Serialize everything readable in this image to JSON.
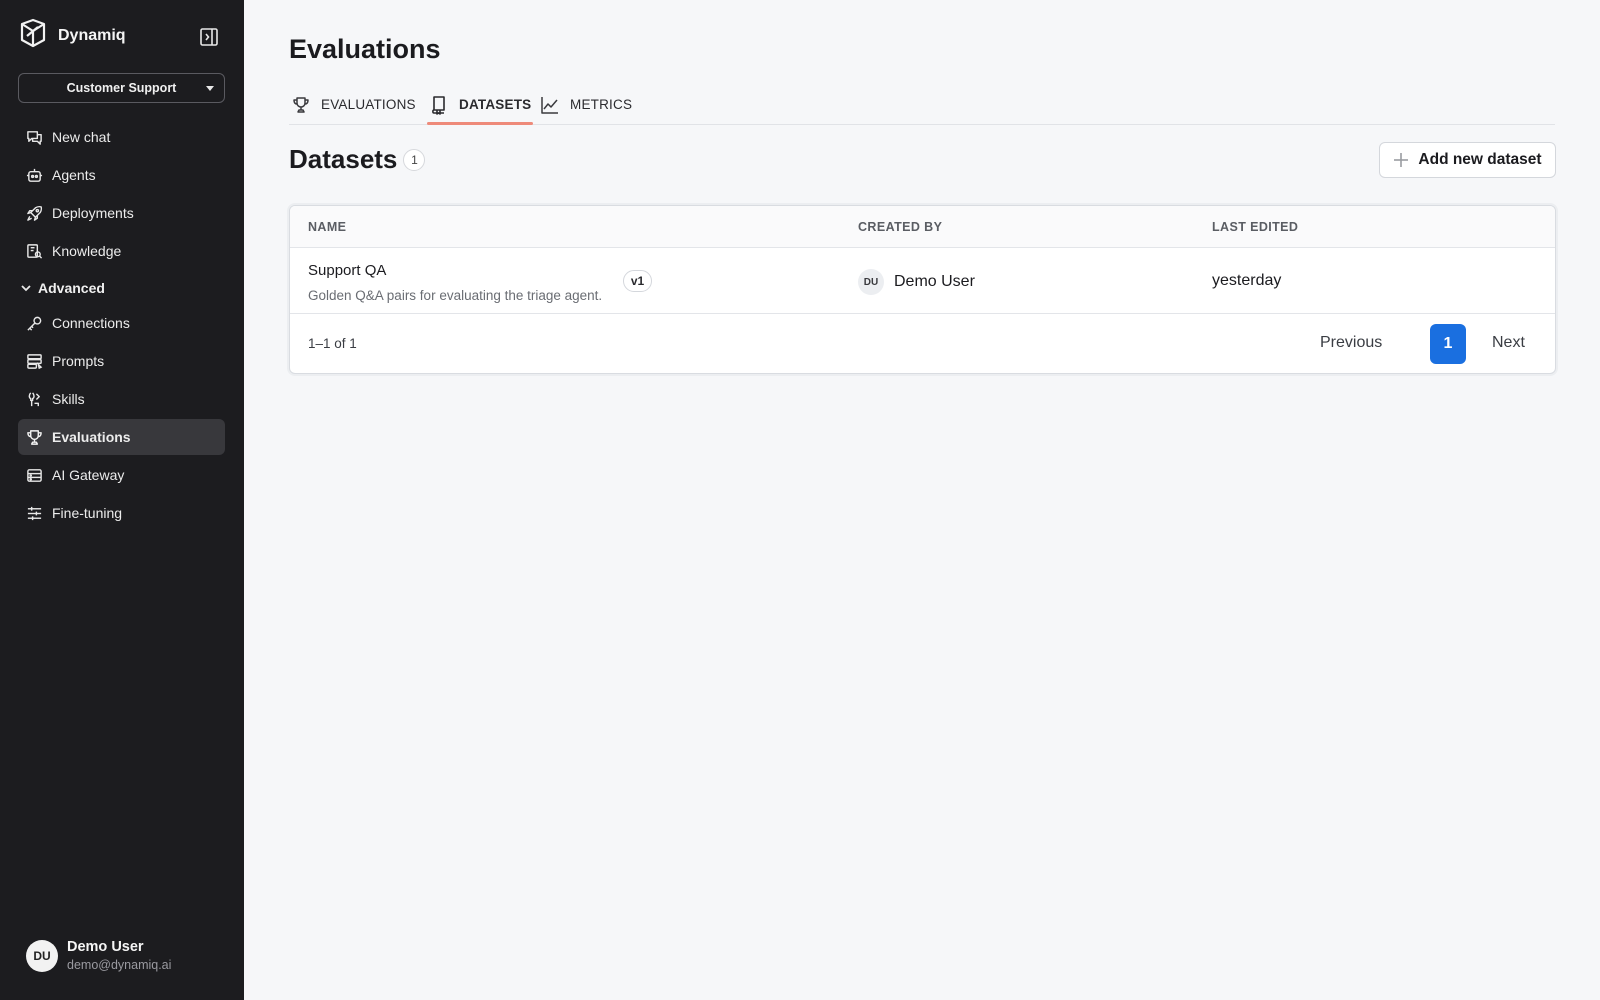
{
  "brand": {
    "name": "Dynamiq"
  },
  "workspace": {
    "selected": "Customer Support"
  },
  "sidebar": {
    "items": [
      {
        "label": "New chat",
        "icon": "chat-icon"
      },
      {
        "label": "Agents",
        "icon": "robot-icon"
      },
      {
        "label": "Deployments",
        "icon": "rocket-icon"
      },
      {
        "label": "Knowledge",
        "icon": "knowledge-icon"
      }
    ],
    "advanced_label": "Advanced",
    "advanced_items": [
      {
        "label": "Connections",
        "icon": "key-icon"
      },
      {
        "label": "Prompts",
        "icon": "prompts-icon"
      },
      {
        "label": "Skills",
        "icon": "skills-icon"
      },
      {
        "label": "Evaluations",
        "icon": "trophy-icon",
        "active": true
      },
      {
        "label": "AI Gateway",
        "icon": "gateway-icon"
      },
      {
        "label": "Fine-tuning",
        "icon": "sliders-icon"
      }
    ]
  },
  "user": {
    "initials": "DU",
    "name": "Demo User",
    "email": "demo@dynamiq.ai"
  },
  "page": {
    "title": "Evaluations"
  },
  "tabs": [
    {
      "label": "EVALUATIONS",
      "icon": "trophy-icon"
    },
    {
      "label": "DATASETS",
      "icon": "dataset-icon",
      "active": true
    },
    {
      "label": "METRICS",
      "icon": "chart-line-icon"
    }
  ],
  "section": {
    "title": "Datasets",
    "count": "1"
  },
  "actions": {
    "add_label": "Add new dataset"
  },
  "table": {
    "columns": [
      "NAME",
      "CREATED BY",
      "LAST EDITED"
    ],
    "rows": [
      {
        "name": "Support QA",
        "description": "Golden Q&A pairs for evaluating the triage agent.",
        "version": "v1",
        "creator_initials": "DU",
        "creator_name": "Demo User",
        "last_edited": "yesterday"
      }
    ]
  },
  "pagination": {
    "range": "1–1 of 1",
    "previous": "Previous",
    "current_page": "1",
    "next": "Next"
  },
  "colors": {
    "sidebar_bg": "#1c1c1f",
    "accent": "#1a6fe0",
    "tab_underline": "#ee8a7a"
  }
}
